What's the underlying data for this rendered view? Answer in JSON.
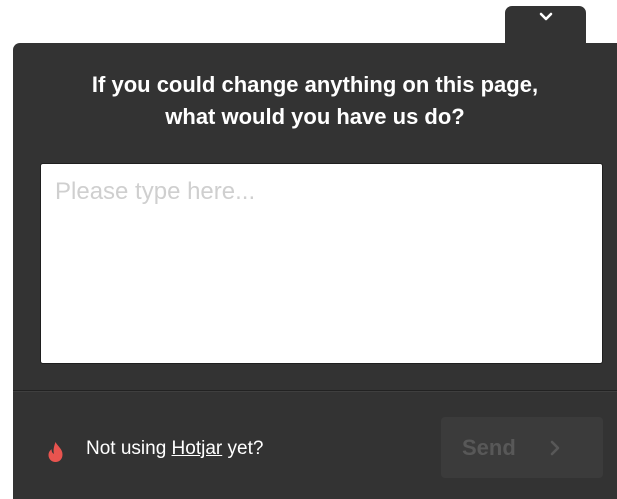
{
  "widget": {
    "collapse_icon": "chevron-down-icon",
    "question_line1": "If you could change anything on this page,",
    "question_line2": "what would you have us do?",
    "answer_placeholder": "Please type here...",
    "answer_value": ""
  },
  "footer": {
    "flame_icon": "hotjar-flame-icon",
    "prefix": "Not using ",
    "link_label": "Hotjar",
    "suffix": " yet?",
    "send_label": "Send",
    "send_icon": "chevron-right-icon"
  },
  "colors": {
    "panel": "#333333",
    "send_disabled_bg": "#3b3b3b",
    "send_disabled_text": "#585858",
    "flame": "#e8544f",
    "placeholder": "#cfcfcf"
  }
}
